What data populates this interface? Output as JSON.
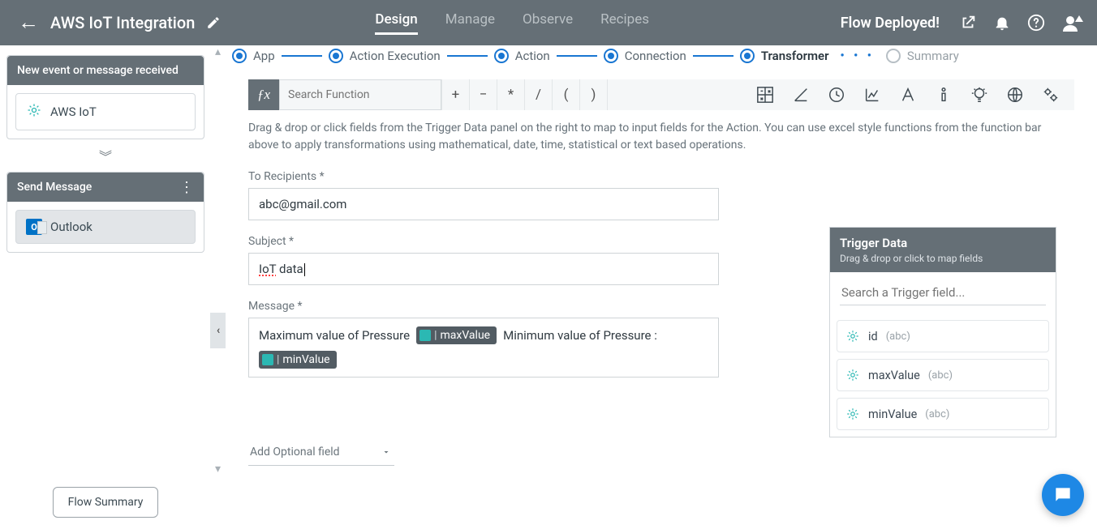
{
  "header": {
    "title": "AWS IoT Integration",
    "tabs": [
      "Design",
      "Manage",
      "Observe",
      "Recipes"
    ],
    "active_tab": 0,
    "deployed_text": "Flow Deployed!"
  },
  "sidebar": {
    "trigger_card_title": "New event or message received",
    "trigger_node": "AWS IoT",
    "action_card_title": "Send Message",
    "action_node": "Outlook",
    "flow_summary_btn": "Flow Summary"
  },
  "steps": {
    "items": [
      "App",
      "Action Execution",
      "Action",
      "Connection",
      "Transformer",
      "Summary"
    ],
    "active_index": 4
  },
  "fnbar": {
    "search_placeholder": "Search Function",
    "ops": [
      "+",
      "−",
      "*",
      "/",
      "(",
      ")"
    ]
  },
  "help_text": "Drag & drop or click fields from the Trigger Data panel on the right to map to input fields for the Action. You can use excel style functions from the function bar above to apply transformations using mathematical, date, time, statistical or text based operations.",
  "form": {
    "to_label": "To Recipients *",
    "to_value": "abc@gmail.com",
    "subject_label": "Subject *",
    "subject_prefix": "IoT",
    "subject_rest": " data",
    "message_label": "Message *",
    "msg_text1": "Maximum value of Pressure",
    "msg_chip1": "maxValue",
    "msg_text2": "Minimum value of Pressure :",
    "msg_chip2": "minValue",
    "optional_label": "Add Optional field"
  },
  "trigger_panel": {
    "title": "Trigger Data",
    "subtitle": "Drag & drop or click to map fields",
    "search_placeholder": "Search a Trigger field...",
    "fields": [
      {
        "name": "id",
        "type": "(abc)"
      },
      {
        "name": "maxValue",
        "type": "(abc)"
      },
      {
        "name": "minValue",
        "type": "(abc)"
      }
    ]
  }
}
